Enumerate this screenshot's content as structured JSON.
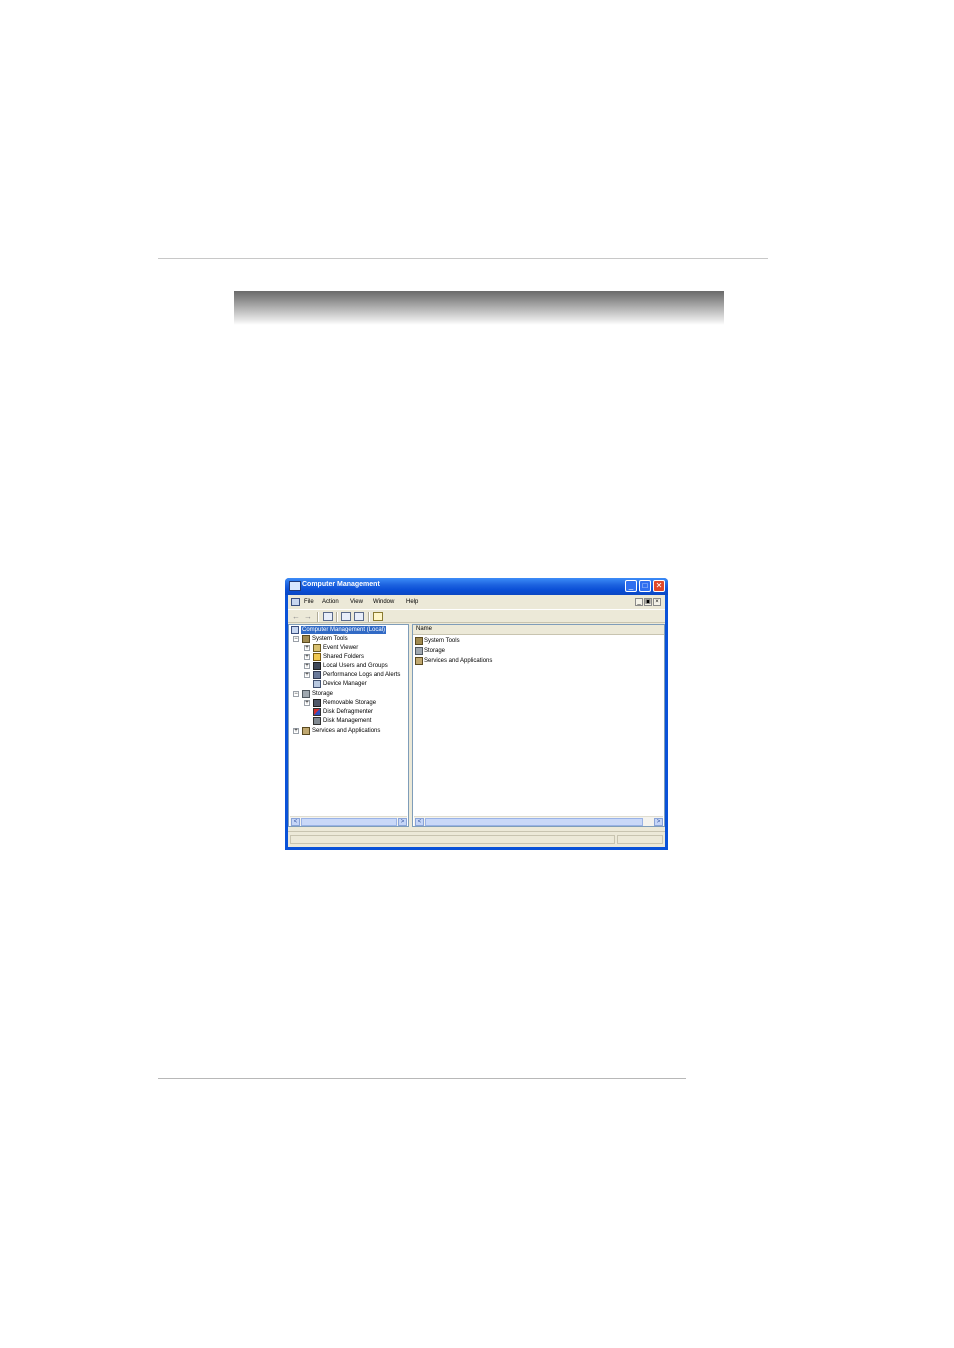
{
  "window": {
    "title": "Computer Management",
    "controls": {
      "minimize": "_",
      "maximize": "□",
      "close": "✕"
    }
  },
  "menu": {
    "items": [
      "File",
      "Action",
      "View",
      "Window",
      "Help"
    ],
    "mdi": {
      "minimize": "_",
      "restore": "▣",
      "close": "×"
    }
  },
  "toolbar": {
    "back": "←",
    "forward": "→"
  },
  "tree": {
    "root": "Computer Management (Local)",
    "system_tools": "System Tools",
    "event_viewer": "Event Viewer",
    "shared_folders": "Shared Folders",
    "local_users": "Local Users and Groups",
    "perf_logs": "Performance Logs and Alerts",
    "device_manager": "Device Manager",
    "storage": "Storage",
    "removable_storage": "Removable Storage",
    "disk_defragmenter": "Disk Defragmenter",
    "disk_management": "Disk Management",
    "services_apps": "Services and Applications"
  },
  "list": {
    "column_name": "Name",
    "items": [
      "System Tools",
      "Storage",
      "Services and Applications"
    ]
  },
  "expanders": {
    "plus": "+",
    "minus": "−"
  },
  "scroll": {
    "left": "<",
    "right": ">"
  },
  "colors": {
    "titlebar": "#0a52d8",
    "selection": "#316ac5",
    "client": "#ece9d8"
  }
}
